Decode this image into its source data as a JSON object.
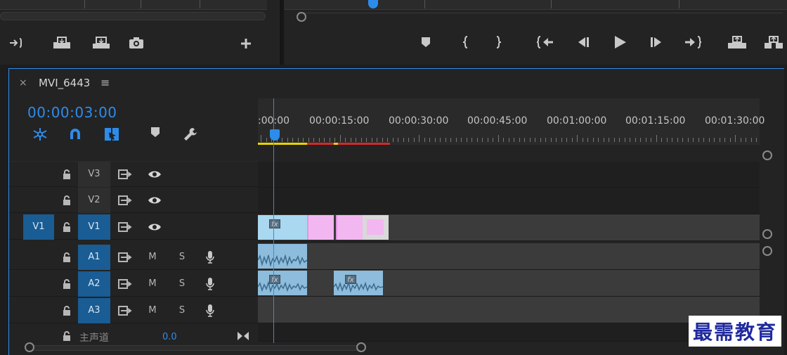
{
  "timeline": {
    "tab_title": "MVI_6443",
    "tab_close": "×",
    "tab_menu": "≡",
    "timecode": "00:00:03:00",
    "ruler_labels": [
      ":00:00",
      "00:00:15:00",
      "00:00:30:00",
      "00:00:45:00",
      "00:01:00:00",
      "00:01:15:00",
      "00:01:30:00"
    ]
  },
  "tracks": {
    "video": [
      {
        "name": "V3",
        "target": "",
        "active": false
      },
      {
        "name": "V2",
        "target": "",
        "active": false
      },
      {
        "name": "V1",
        "target": "V1",
        "active": true
      }
    ],
    "audio": [
      {
        "name": "A1",
        "m": "M",
        "s": "S"
      },
      {
        "name": "A2",
        "m": "M",
        "s": "S"
      },
      {
        "name": "A3",
        "m": "M",
        "s": "S"
      }
    ],
    "master_label": "主声道",
    "master_value": "0.0"
  },
  "clips": {
    "fx_label": "fx"
  },
  "watermark": "最需教育",
  "colors": {
    "accent": "#2d8ceb",
    "target_active": "#1a5c94",
    "video_clip": "#a9d8f0",
    "pink_clip": "#f2b7f0",
    "audio_clip": "#8dbcdc",
    "render_yellow": "#e6d400",
    "render_red": "#d42a2a"
  }
}
